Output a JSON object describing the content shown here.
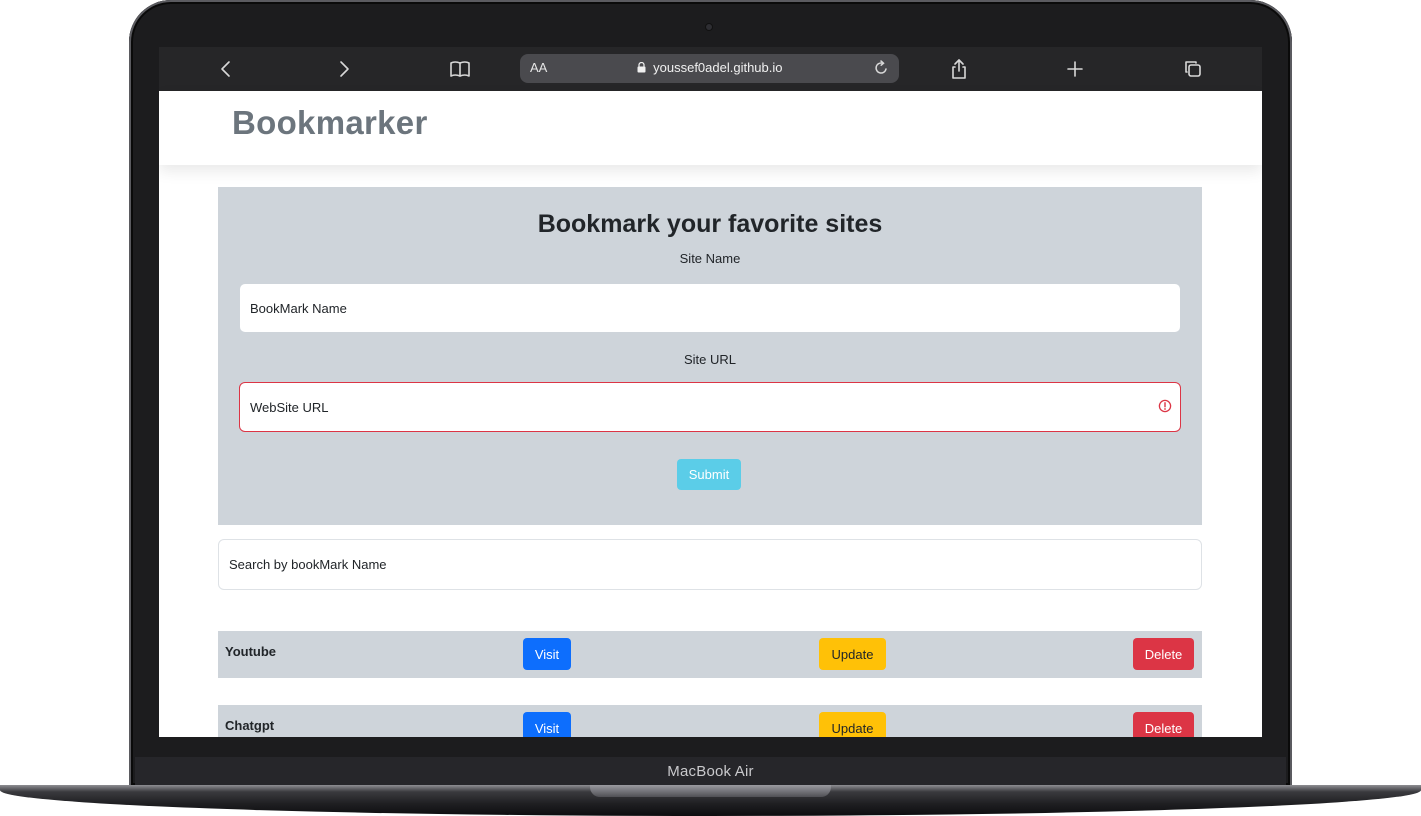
{
  "device": {
    "label": "MacBook Air"
  },
  "browser": {
    "text_size_label": "AA",
    "url": "youssef0adel.github.io"
  },
  "navbar": {
    "brand": "Bookmarker"
  },
  "form": {
    "title": "Bookmark your favorite sites",
    "site_name_label": "Site Name",
    "site_name_placeholder": "BookMark Name",
    "site_url_label": "Site URL",
    "site_url_placeholder": "WebSite URL",
    "site_url_state": "invalid",
    "submit_label": "Submit"
  },
  "search": {
    "placeholder": "Search by bookMark Name"
  },
  "bookmarks": [
    {
      "name": "Youtube",
      "visit_label": "Visit",
      "update_label": "Update",
      "delete_label": "Delete"
    },
    {
      "name": "Chatgpt",
      "visit_label": "Visit",
      "update_label": "Update",
      "delete_label": "Delete"
    }
  ],
  "colors": {
    "panel_bg": "#ced4da",
    "brand_text": "#6c757d",
    "submit": "#5bcde8",
    "visit": "#0d6efd",
    "update": "#ffc107",
    "delete": "#dc3545",
    "invalid_border": "#dc3545"
  }
}
